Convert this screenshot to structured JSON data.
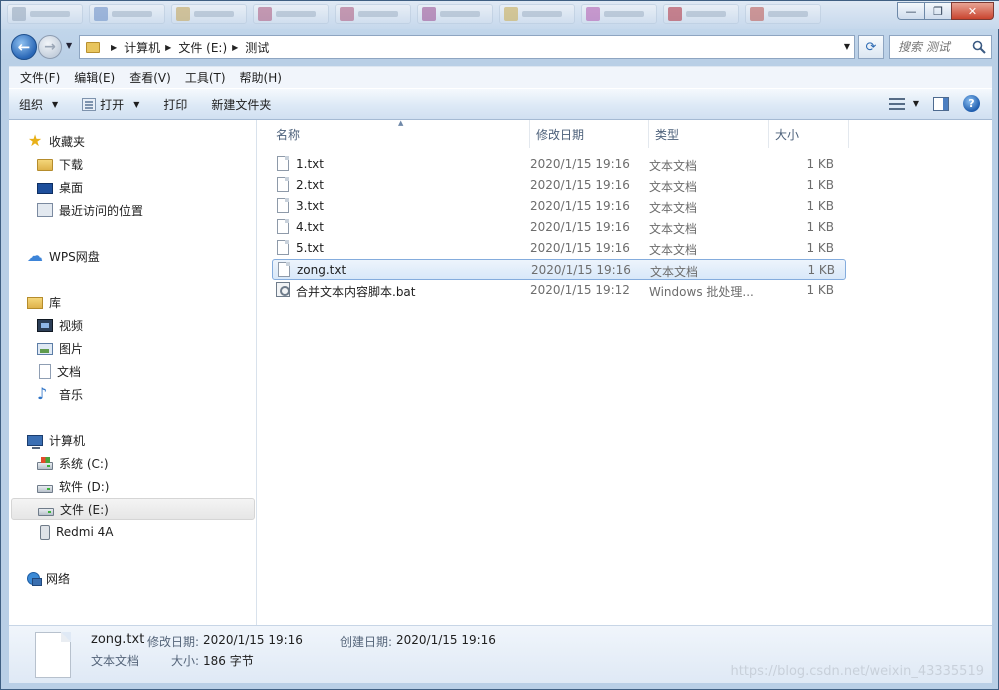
{
  "window": {
    "controls": {
      "minimize": "—",
      "maximize": "❐",
      "close": "✕"
    }
  },
  "address": {
    "crumbs": [
      "计算机",
      "文件 (E:)",
      "测试"
    ],
    "search_placeholder": "搜索 测试"
  },
  "menu": [
    "文件(F)",
    "编辑(E)",
    "查看(V)",
    "工具(T)",
    "帮助(H)"
  ],
  "toolbar": {
    "organize": "组织",
    "open": "打开",
    "print": "打印",
    "new_folder": "新建文件夹"
  },
  "nav": {
    "favorites": {
      "label": "收藏夹",
      "items": [
        "下载",
        "桌面",
        "最近访问的位置"
      ]
    },
    "wps": "WPS网盘",
    "libraries": {
      "label": "库",
      "items": [
        "视频",
        "图片",
        "文档",
        "音乐"
      ]
    },
    "computer": {
      "label": "计算机",
      "items": [
        "系统 (C:)",
        "软件 (D:)",
        "文件 (E:)",
        "Redmi 4A"
      ]
    },
    "network": "网络"
  },
  "columns": {
    "name": "名称",
    "date": "修改日期",
    "type": "类型",
    "size": "大小"
  },
  "files": [
    {
      "name": "1.txt",
      "date": "2020/1/15 19:16",
      "type": "文本文档",
      "size": "1 KB"
    },
    {
      "name": "2.txt",
      "date": "2020/1/15 19:16",
      "type": "文本文档",
      "size": "1 KB"
    },
    {
      "name": "3.txt",
      "date": "2020/1/15 19:16",
      "type": "文本文档",
      "size": "1 KB"
    },
    {
      "name": "4.txt",
      "date": "2020/1/15 19:16",
      "type": "文本文档",
      "size": "1 KB"
    },
    {
      "name": "5.txt",
      "date": "2020/1/15 19:16",
      "type": "文本文档",
      "size": "1 KB"
    },
    {
      "name": "zong.txt",
      "date": "2020/1/15 19:16",
      "type": "文本文档",
      "size": "1 KB"
    },
    {
      "name": "合并文本内容脚本.bat",
      "date": "2020/1/15 19:12",
      "type": "Windows 批处理...",
      "size": "1 KB"
    }
  ],
  "details": {
    "name": "zong.txt",
    "modified_label": "修改日期:",
    "modified": "2020/1/15 19:16",
    "created_label": "创建日期:",
    "created": "2020/1/15 19:16",
    "type": "文本文档",
    "size_label": "大小:",
    "size": "186 字节"
  },
  "watermark": "https://blog.csdn.net/weixin_43335519"
}
